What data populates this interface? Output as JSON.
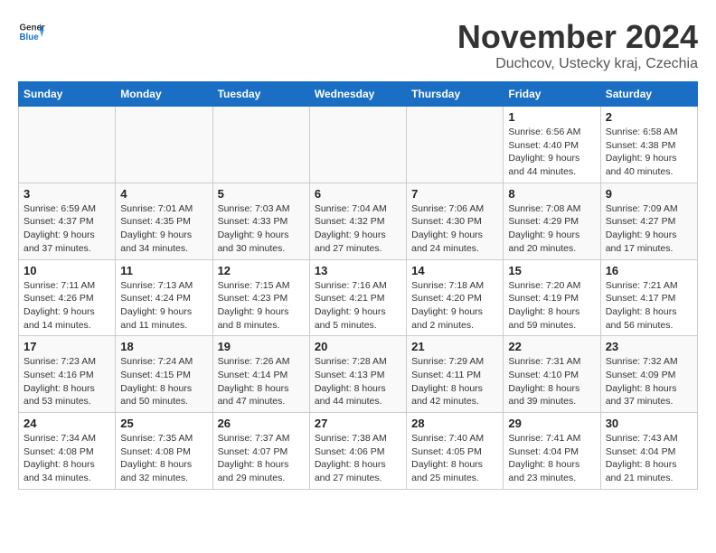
{
  "header": {
    "logo_general": "General",
    "logo_blue": "Blue",
    "month_title": "November 2024",
    "subtitle": "Duchcov, Ustecky kraj, Czechia"
  },
  "days_of_week": [
    "Sunday",
    "Monday",
    "Tuesday",
    "Wednesday",
    "Thursday",
    "Friday",
    "Saturday"
  ],
  "weeks": [
    [
      {
        "day": "",
        "info": ""
      },
      {
        "day": "",
        "info": ""
      },
      {
        "day": "",
        "info": ""
      },
      {
        "day": "",
        "info": ""
      },
      {
        "day": "",
        "info": ""
      },
      {
        "day": "1",
        "info": "Sunrise: 6:56 AM\nSunset: 4:40 PM\nDaylight: 9 hours\nand 44 minutes."
      },
      {
        "day": "2",
        "info": "Sunrise: 6:58 AM\nSunset: 4:38 PM\nDaylight: 9 hours\nand 40 minutes."
      }
    ],
    [
      {
        "day": "3",
        "info": "Sunrise: 6:59 AM\nSunset: 4:37 PM\nDaylight: 9 hours\nand 37 minutes."
      },
      {
        "day": "4",
        "info": "Sunrise: 7:01 AM\nSunset: 4:35 PM\nDaylight: 9 hours\nand 34 minutes."
      },
      {
        "day": "5",
        "info": "Sunrise: 7:03 AM\nSunset: 4:33 PM\nDaylight: 9 hours\nand 30 minutes."
      },
      {
        "day": "6",
        "info": "Sunrise: 7:04 AM\nSunset: 4:32 PM\nDaylight: 9 hours\nand 27 minutes."
      },
      {
        "day": "7",
        "info": "Sunrise: 7:06 AM\nSunset: 4:30 PM\nDaylight: 9 hours\nand 24 minutes."
      },
      {
        "day": "8",
        "info": "Sunrise: 7:08 AM\nSunset: 4:29 PM\nDaylight: 9 hours\nand 20 minutes."
      },
      {
        "day": "9",
        "info": "Sunrise: 7:09 AM\nSunset: 4:27 PM\nDaylight: 9 hours\nand 17 minutes."
      }
    ],
    [
      {
        "day": "10",
        "info": "Sunrise: 7:11 AM\nSunset: 4:26 PM\nDaylight: 9 hours\nand 14 minutes."
      },
      {
        "day": "11",
        "info": "Sunrise: 7:13 AM\nSunset: 4:24 PM\nDaylight: 9 hours\nand 11 minutes."
      },
      {
        "day": "12",
        "info": "Sunrise: 7:15 AM\nSunset: 4:23 PM\nDaylight: 9 hours\nand 8 minutes."
      },
      {
        "day": "13",
        "info": "Sunrise: 7:16 AM\nSunset: 4:21 PM\nDaylight: 9 hours\nand 5 minutes."
      },
      {
        "day": "14",
        "info": "Sunrise: 7:18 AM\nSunset: 4:20 PM\nDaylight: 9 hours\nand 2 minutes."
      },
      {
        "day": "15",
        "info": "Sunrise: 7:20 AM\nSunset: 4:19 PM\nDaylight: 8 hours\nand 59 minutes."
      },
      {
        "day": "16",
        "info": "Sunrise: 7:21 AM\nSunset: 4:17 PM\nDaylight: 8 hours\nand 56 minutes."
      }
    ],
    [
      {
        "day": "17",
        "info": "Sunrise: 7:23 AM\nSunset: 4:16 PM\nDaylight: 8 hours\nand 53 minutes."
      },
      {
        "day": "18",
        "info": "Sunrise: 7:24 AM\nSunset: 4:15 PM\nDaylight: 8 hours\nand 50 minutes."
      },
      {
        "day": "19",
        "info": "Sunrise: 7:26 AM\nSunset: 4:14 PM\nDaylight: 8 hours\nand 47 minutes."
      },
      {
        "day": "20",
        "info": "Sunrise: 7:28 AM\nSunset: 4:13 PM\nDaylight: 8 hours\nand 44 minutes."
      },
      {
        "day": "21",
        "info": "Sunrise: 7:29 AM\nSunset: 4:11 PM\nDaylight: 8 hours\nand 42 minutes."
      },
      {
        "day": "22",
        "info": "Sunrise: 7:31 AM\nSunset: 4:10 PM\nDaylight: 8 hours\nand 39 minutes."
      },
      {
        "day": "23",
        "info": "Sunrise: 7:32 AM\nSunset: 4:09 PM\nDaylight: 8 hours\nand 37 minutes."
      }
    ],
    [
      {
        "day": "24",
        "info": "Sunrise: 7:34 AM\nSunset: 4:08 PM\nDaylight: 8 hours\nand 34 minutes."
      },
      {
        "day": "25",
        "info": "Sunrise: 7:35 AM\nSunset: 4:08 PM\nDaylight: 8 hours\nand 32 minutes."
      },
      {
        "day": "26",
        "info": "Sunrise: 7:37 AM\nSunset: 4:07 PM\nDaylight: 8 hours\nand 29 minutes."
      },
      {
        "day": "27",
        "info": "Sunrise: 7:38 AM\nSunset: 4:06 PM\nDaylight: 8 hours\nand 27 minutes."
      },
      {
        "day": "28",
        "info": "Sunrise: 7:40 AM\nSunset: 4:05 PM\nDaylight: 8 hours\nand 25 minutes."
      },
      {
        "day": "29",
        "info": "Sunrise: 7:41 AM\nSunset: 4:04 PM\nDaylight: 8 hours\nand 23 minutes."
      },
      {
        "day": "30",
        "info": "Sunrise: 7:43 AM\nSunset: 4:04 PM\nDaylight: 8 hours\nand 21 minutes."
      }
    ]
  ]
}
